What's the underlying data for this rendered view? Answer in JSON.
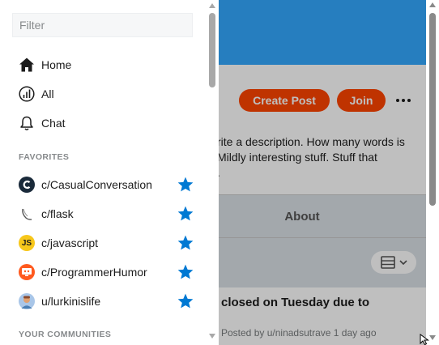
{
  "page": {
    "create_post_label": "Create Post",
    "join_label": "Join",
    "description_lines": [
      "rite a description. How many words is",
      "Mildly interesting stuff. Stuff that",
      "."
    ],
    "about_tab_label": "About",
    "post_title": "closed on Tuesday due to",
    "post_meta_prefix": "Posted by",
    "post_author": "u/ninadsutrave",
    "post_time": "1 day ago",
    "colors": {
      "banner": "#33a8ff",
      "accent": "#ff4500",
      "star": "#0079d3"
    }
  },
  "dropdown": {
    "filter_placeholder": "Filter",
    "nav": [
      {
        "label": "Home",
        "icon": "home-icon"
      },
      {
        "label": "All",
        "icon": "all-chart-icon"
      },
      {
        "label": "Chat",
        "icon": "bell-icon"
      }
    ],
    "favorites_heading": "FAVORITES",
    "favorites": [
      {
        "label": "c/CasualConversation",
        "icon": "casual-conversation-avatar"
      },
      {
        "label": "c/flask",
        "icon": "flask-avatar"
      },
      {
        "label": "c/javascript",
        "avatar_text": "JS",
        "icon": "javascript-avatar"
      },
      {
        "label": "c/ProgrammerHumor",
        "icon": "programmer-humor-avatar"
      },
      {
        "label": "u/lurkinislife",
        "icon": "user-avatar"
      }
    ],
    "your_communities_heading": "YOUR COMMUNITIES"
  }
}
